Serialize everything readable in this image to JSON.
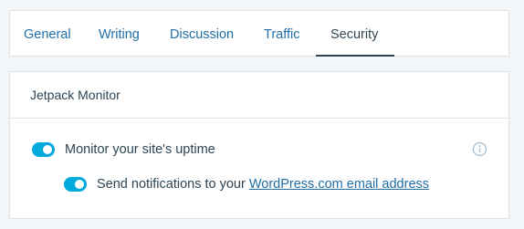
{
  "tabs": [
    {
      "label": "General"
    },
    {
      "label": "Writing"
    },
    {
      "label": "Discussion"
    },
    {
      "label": "Traffic"
    },
    {
      "label": "Security",
      "active": true
    }
  ],
  "module": {
    "title": "Jetpack Monitor",
    "settings": {
      "uptime": {
        "label": "Monitor your site's uptime",
        "enabled": true
      },
      "notifications": {
        "label_prefix": "Send notifications to your ",
        "link_text": "WordPress.com email address",
        "enabled": true
      }
    },
    "info_icon": "info-circle-icon"
  },
  "colors": {
    "accent": "#00aadc",
    "link": "#1f6ea5",
    "text": "#2e4453",
    "background": "#f3f6f8"
  }
}
